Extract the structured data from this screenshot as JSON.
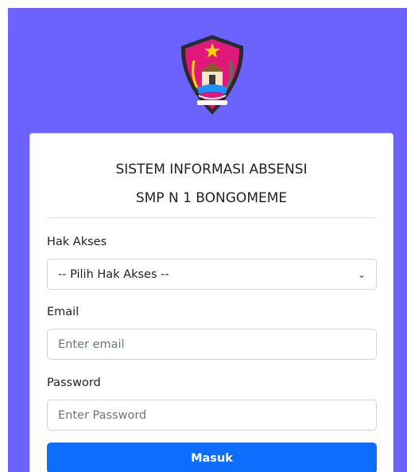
{
  "header": {
    "logo_icon": "regional-emblem-icon"
  },
  "card": {
    "title_line1": "SISTEM INFORMASI ABSENSI",
    "title_line2": "SMP N 1 BONGOMEME"
  },
  "form": {
    "role": {
      "label": "Hak Akses",
      "selected": "-- Pilih Hak Akses --"
    },
    "email": {
      "label": "Email",
      "placeholder": "Enter email"
    },
    "password": {
      "label": "Password",
      "placeholder": "Enter Password"
    },
    "submit_label": "Masuk"
  },
  "colors": {
    "background": "#6c63fe",
    "button": "#0d6efd"
  }
}
